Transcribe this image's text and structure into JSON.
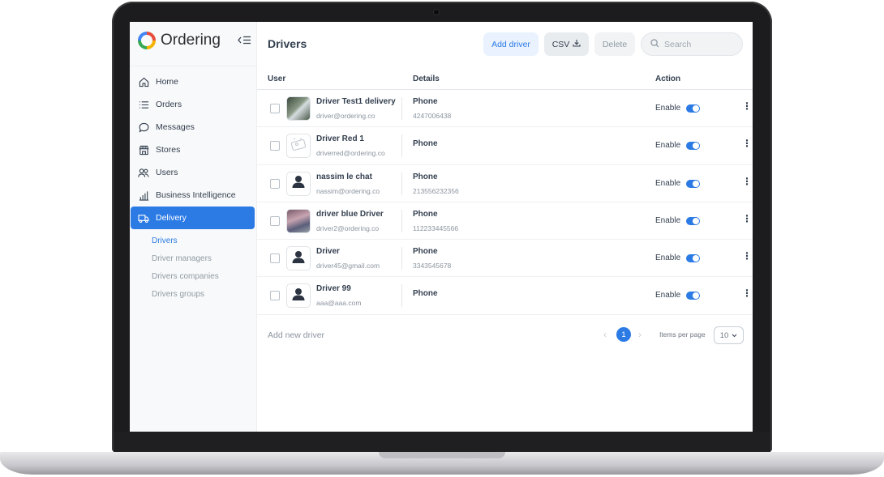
{
  "app": {
    "brand": "Ordering"
  },
  "sidebar": {
    "items": [
      {
        "label": "Home",
        "icon": "home-icon"
      },
      {
        "label": "Orders",
        "icon": "list-icon"
      },
      {
        "label": "Messages",
        "icon": "chat-icon"
      },
      {
        "label": "Stores",
        "icon": "store-icon"
      },
      {
        "label": "Users",
        "icon": "users-icon"
      },
      {
        "label": "Business Intelligence",
        "icon": "bar-chart-icon"
      },
      {
        "label": "Delivery",
        "icon": "truck-icon",
        "active": true
      }
    ],
    "subitems": [
      {
        "label": "Drivers",
        "active": true
      },
      {
        "label": "Driver managers"
      },
      {
        "label": "Drivers companies"
      },
      {
        "label": "Drivers groups"
      }
    ]
  },
  "header": {
    "title": "Drivers",
    "add_label": "Add driver",
    "csv_label": "CSV",
    "delete_label": "Delete",
    "search_placeholder": "Search"
  },
  "table": {
    "columns": {
      "user": "User",
      "details": "Details",
      "action": "Action"
    },
    "rows": [
      {
        "name": "Driver Test1 delivery",
        "email": "driver@ordering.co",
        "phone_label": "Phone",
        "phone": "4247006438",
        "status": "Enable",
        "avatar": "photo"
      },
      {
        "name": "Driver Red 1",
        "email": "driverred@ordering.co",
        "phone_label": "Phone",
        "phone": "",
        "status": "Enable",
        "avatar": "image-placeholder"
      },
      {
        "name": "nassim le chat",
        "email": "nassim@ordering.co",
        "phone_label": "Phone",
        "phone": "213556232356",
        "status": "Enable",
        "avatar": "default"
      },
      {
        "name": "driver blue Driver",
        "email": "driver2@ordering.co",
        "phone_label": "Phone",
        "phone": "112233445566",
        "status": "Enable",
        "avatar": "photo"
      },
      {
        "name": "Driver",
        "email": "driver45@gmail.com",
        "phone_label": "Phone",
        "phone": "3343545678",
        "status": "Enable",
        "avatar": "default"
      },
      {
        "name": "Driver 99",
        "email": "aaa@aaa.com",
        "phone_label": "Phone",
        "phone": "",
        "status": "Enable",
        "avatar": "default"
      }
    ]
  },
  "footer": {
    "add_new": "Add new driver",
    "current_page": "1",
    "items_per_page_label": "Items per page",
    "items_per_page": "10"
  },
  "colors": {
    "accent": "#2c7be5",
    "text": "#344050",
    "muted": "#8a949e"
  }
}
